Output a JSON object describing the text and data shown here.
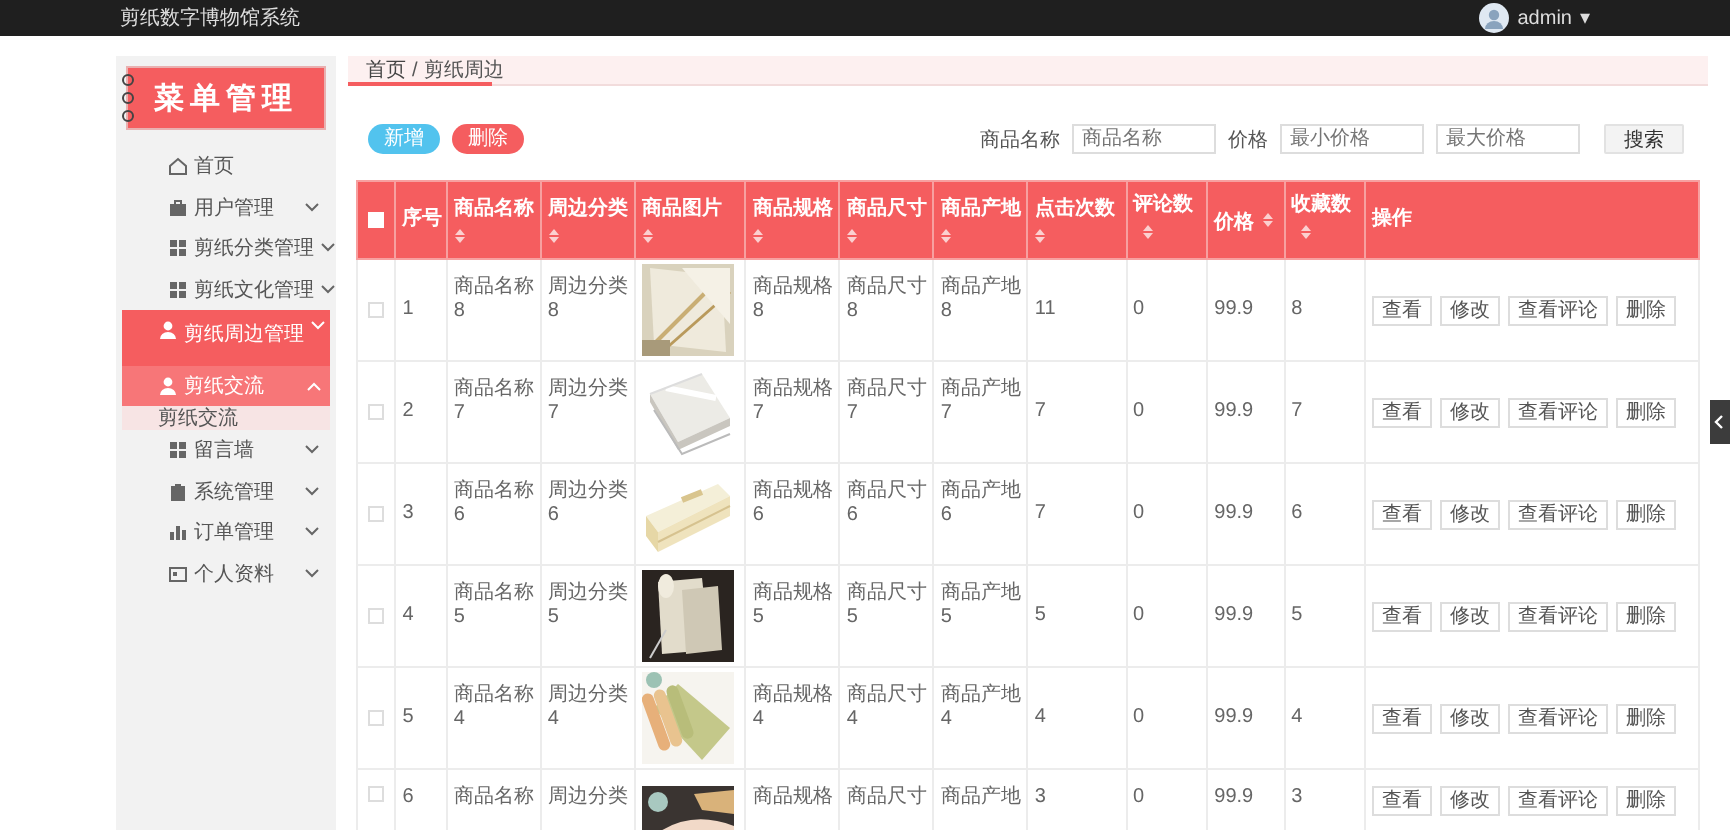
{
  "top_bar": {
    "title": "剪纸数字博物馆系统",
    "user": "admin",
    "caret": "▾"
  },
  "sidebar": {
    "title": "菜单管理",
    "items": [
      {
        "kind": "link",
        "label": "首页",
        "selected": false
      },
      {
        "kind": "group",
        "label": "用户管理",
        "selected": false,
        "expanded": false
      },
      {
        "kind": "group",
        "label": "剪纸分类管理",
        "selected": false,
        "expanded": false
      },
      {
        "kind": "group",
        "label": "剪纸文化管理",
        "selected": false,
        "expanded": false
      },
      {
        "kind": "group",
        "label": "剪纸周边管理",
        "selected": true,
        "expanded": false
      },
      {
        "kind": "group",
        "label": "剪纸交流",
        "selected": false,
        "expanded": true,
        "children": [
          {
            "label": "剪纸交流",
            "selected": true
          }
        ]
      },
      {
        "kind": "group",
        "label": "留言墙",
        "selected": false,
        "expanded": false
      },
      {
        "kind": "group",
        "label": "系统管理",
        "selected": false,
        "expanded": false
      },
      {
        "kind": "group",
        "label": "订单管理",
        "selected": false,
        "expanded": false
      },
      {
        "kind": "group",
        "label": "个人资料",
        "selected": false,
        "expanded": false
      }
    ]
  },
  "breadcrumb": {
    "items": [
      "首页",
      "剪纸周边"
    ],
    "separator": "/"
  },
  "actions": {
    "buttons": [
      {
        "kind": "add",
        "label": "新增"
      },
      {
        "kind": "delete",
        "label": "删除"
      }
    ]
  },
  "search": {
    "name_label": "商品名称",
    "name_placeholder": "商品名称",
    "price_label": "价格",
    "min_placeholder": "最小价格",
    "max_placeholder": "最大价格",
    "button": "搜索"
  },
  "table": {
    "select_all": {
      "checked": false
    },
    "columns": [
      {
        "label": "序号",
        "sortable": false
      },
      {
        "label": "商品名称",
        "sortable": true
      },
      {
        "label": "周边分类",
        "sortable": true
      },
      {
        "label": "商品图片",
        "sortable": true
      },
      {
        "label": "商品规格",
        "sortable": true
      },
      {
        "label": "商品尺寸",
        "sortable": true
      },
      {
        "label": "商品产地",
        "sortable": true
      },
      {
        "label": "点击次数",
        "sortable": true
      },
      {
        "label": "评论数",
        "sortable": true
      },
      {
        "label": "价格",
        "sortable": true
      },
      {
        "label": "收藏数",
        "sortable": true
      },
      {
        "label": "操作",
        "sortable": false
      }
    ],
    "rows": [
      {
        "checked": false,
        "index": "1",
        "name": "商品名称8",
        "category": "周边分类8",
        "spec": "商品规格8",
        "size": "商品尺寸8",
        "origin": "商品产地8",
        "clicks": "11",
        "comments": "0",
        "price": "99.9",
        "favorites": "8",
        "actions": [
          "查看",
          "修改",
          "查看评论",
          "删除"
        ]
      },
      {
        "checked": false,
        "index": "2",
        "name": "商品名称7",
        "category": "周边分类7",
        "spec": "商品规格7",
        "size": "商品尺寸7",
        "origin": "商品产地7",
        "clicks": "7",
        "comments": "0",
        "price": "99.9",
        "favorites": "7",
        "actions": [
          "查看",
          "修改",
          "查看评论",
          "删除"
        ]
      },
      {
        "checked": false,
        "index": "3",
        "name": "商品名称6",
        "category": "周边分类6",
        "spec": "商品规格6",
        "size": "商品尺寸6",
        "origin": "商品产地6",
        "clicks": "7",
        "comments": "0",
        "price": "99.9",
        "favorites": "6",
        "actions": [
          "查看",
          "修改",
          "查看评论",
          "删除"
        ]
      },
      {
        "checked": false,
        "index": "4",
        "name": "商品名称5",
        "category": "周边分类5",
        "spec": "商品规格5",
        "size": "商品尺寸5",
        "origin": "商品产地5",
        "clicks": "5",
        "comments": "0",
        "price": "99.9",
        "favorites": "5",
        "actions": [
          "查看",
          "修改",
          "查看评论",
          "删除"
        ]
      },
      {
        "checked": false,
        "index": "5",
        "name": "商品名称4",
        "category": "周边分类4",
        "spec": "商品规格4",
        "size": "商品尺寸4",
        "origin": "商品产地4",
        "clicks": "4",
        "comments": "0",
        "price": "99.9",
        "favorites": "4",
        "actions": [
          "查看",
          "修改",
          "查看评论",
          "删除"
        ]
      },
      {
        "checked": false,
        "index": "6",
        "name": "商品名称",
        "category": "周边分类",
        "spec": "商品规格",
        "size": "商品尺寸",
        "origin": "商品产地",
        "clicks": "3",
        "comments": "0",
        "price": "99.9",
        "favorites": "3",
        "actions": [
          "查看",
          "修改",
          "查看评论",
          "删除"
        ]
      }
    ]
  }
}
